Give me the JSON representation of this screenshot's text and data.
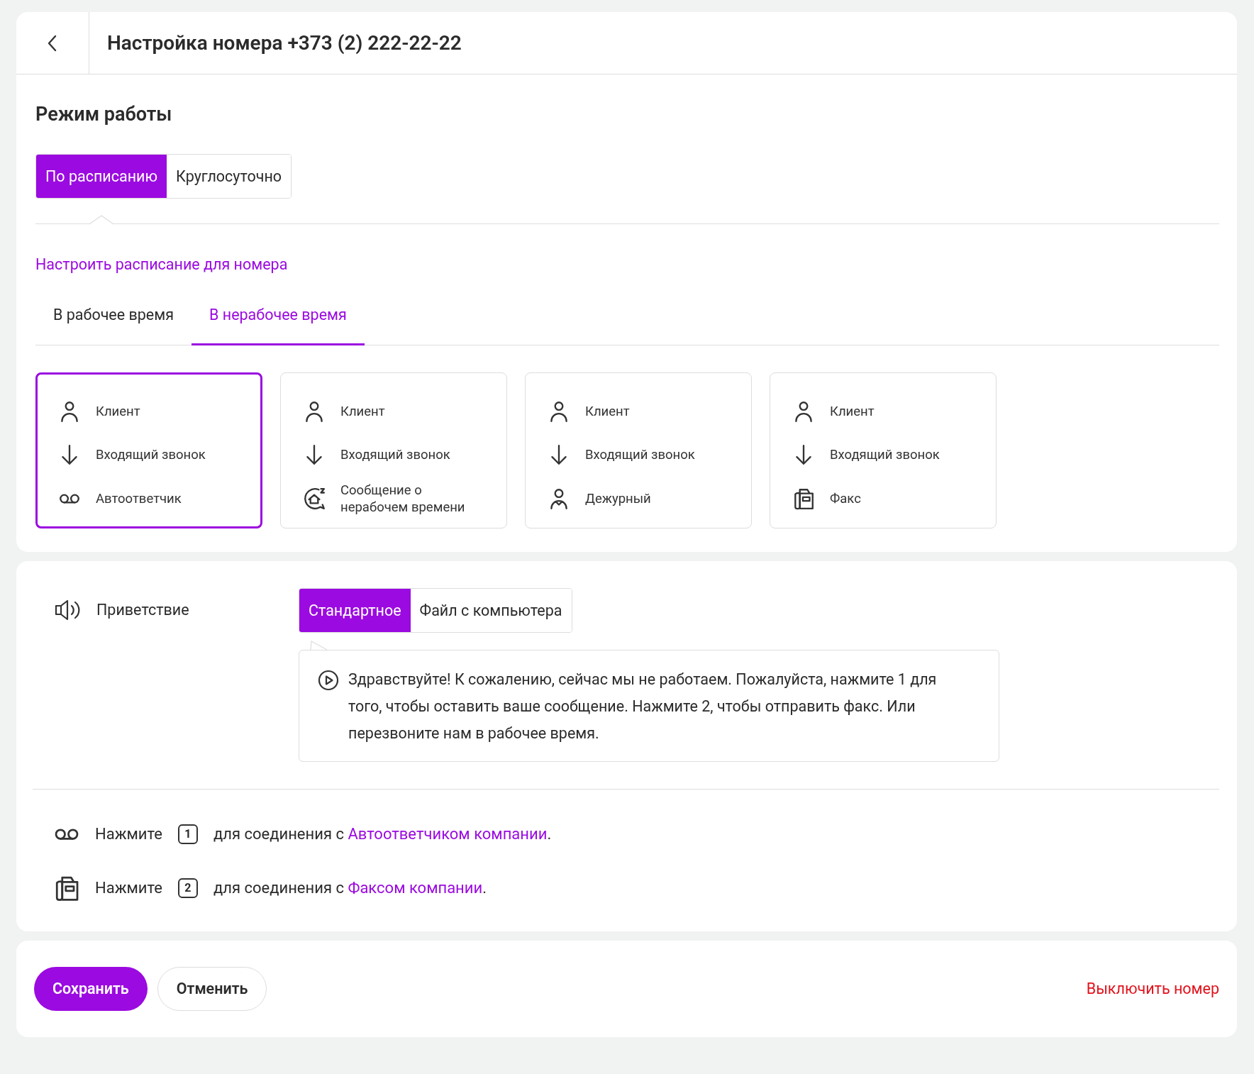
{
  "header": {
    "title": "Настройка номера +373 (2) 222-22-22"
  },
  "schedule": {
    "title": "Режим работы",
    "modes": [
      {
        "label": "По расписанию",
        "selected": true
      },
      {
        "label": "Круглосуточно",
        "selected": false
      }
    ],
    "link": "Настроить расписание для номера"
  },
  "time_tabs": [
    {
      "label": "В рабочее время",
      "selected": false
    },
    {
      "label": "В нерабочее время",
      "selected": true
    }
  ],
  "scenarios": [
    {
      "selected": true,
      "items": [
        {
          "kind": "client",
          "label": "Клиент"
        },
        {
          "kind": "incoming",
          "label": "Входящий звонок"
        },
        {
          "kind": "voicemail",
          "label": "Автоответчик"
        }
      ]
    },
    {
      "selected": false,
      "items": [
        {
          "kind": "client",
          "label": "Клиент"
        },
        {
          "kind": "incoming",
          "label": "Входящий звонок"
        },
        {
          "kind": "message",
          "label": "Сообщение о нерабочем времени"
        }
      ]
    },
    {
      "selected": false,
      "items": [
        {
          "kind": "client",
          "label": "Клиент"
        },
        {
          "kind": "incoming",
          "label": "Входящий звонок"
        },
        {
          "kind": "duty",
          "label": "Дежурный"
        }
      ]
    },
    {
      "selected": false,
      "items": [
        {
          "kind": "client",
          "label": "Клиент"
        },
        {
          "kind": "incoming",
          "label": "Входящий звонок"
        },
        {
          "kind": "fax",
          "label": "Факс"
        }
      ]
    }
  ],
  "greeting": {
    "label": "Приветствие",
    "sources": [
      {
        "label": "Стандартное",
        "selected": true
      },
      {
        "label": "Файл с компьютера",
        "selected": false
      }
    ],
    "message": "Здравствуйте! К сожалению, сейчас мы не работаем. Пожалуйста, нажмите 1 для того, чтобы оставить ваше сообщение. Нажмите 2, чтобы отправить факс. Или перезвоните нам в рабочее время."
  },
  "options": [
    {
      "kind": "voicemail",
      "prefix": "Нажмите",
      "key": "1",
      "text": "для соединения с",
      "link": "Автоответчиком компании",
      "suffix": "."
    },
    {
      "kind": "fax",
      "prefix": "Нажмите",
      "key": "2",
      "text": "для соединения с",
      "link": "Факсом компании",
      "suffix": "."
    }
  ],
  "actions": {
    "save": "Сохранить",
    "cancel": "Отменить",
    "disable": "Выключить номер"
  }
}
